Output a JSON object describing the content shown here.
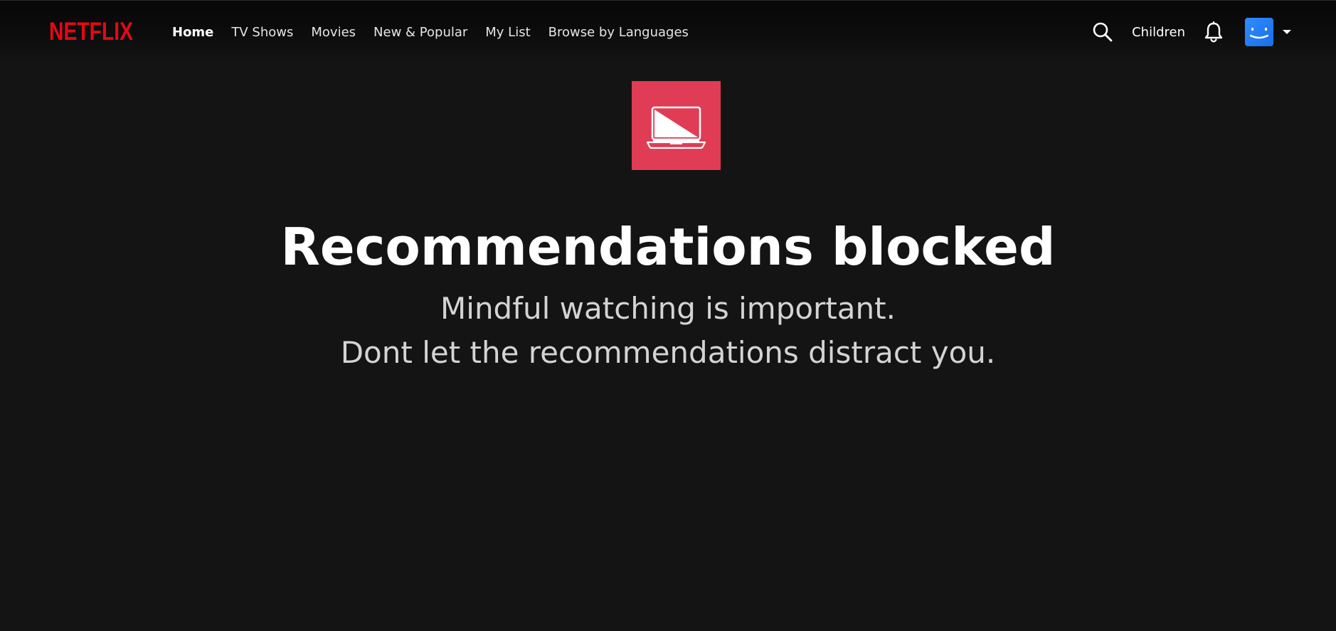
{
  "header": {
    "logo_text": "NETFLIX",
    "nav": [
      {
        "label": "Home",
        "active": true
      },
      {
        "label": "TV Shows",
        "active": false
      },
      {
        "label": "Movies",
        "active": false
      },
      {
        "label": "New & Popular",
        "active": false
      },
      {
        "label": "My List",
        "active": false
      },
      {
        "label": "Browse by Languages",
        "active": false
      }
    ],
    "kids_label": "Children",
    "icons": {
      "search": "search-icon",
      "notifications": "bell-icon",
      "profile_caret": "caret-down-icon"
    }
  },
  "main": {
    "icon": "laptop-blocked-icon",
    "title": "Recommendations blocked",
    "subtitle_line1": "Mindful watching is important.",
    "subtitle_line2": "Dont let the recommendations distract you."
  },
  "colors": {
    "brand_red": "#e50914",
    "background": "#141414",
    "icon_tile": "#e03c55",
    "avatar_blue": "#1a6fe8"
  }
}
